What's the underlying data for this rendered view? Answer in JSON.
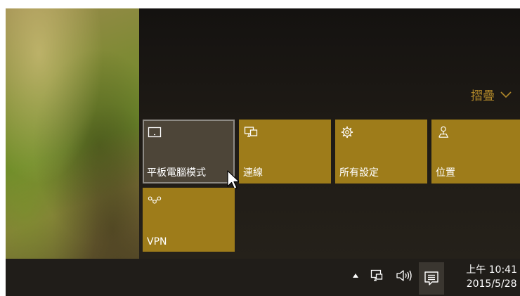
{
  "action_center": {
    "collapse_label": "摺疊",
    "tiles": [
      {
        "label": "平板電腦模式",
        "icon": "tablet-mode-icon",
        "state": "off"
      },
      {
        "label": "連線",
        "icon": "connect-icon",
        "state": "on"
      },
      {
        "label": "所有設定",
        "icon": "gear-icon",
        "state": "on"
      },
      {
        "label": "位置",
        "icon": "location-icon",
        "state": "on"
      },
      {
        "label": "VPN",
        "icon": "vpn-icon",
        "state": "on"
      }
    ]
  },
  "taskbar": {
    "clock": {
      "time": "上午 10:41",
      "date": "2015/5/28"
    },
    "tray_icons": [
      "show-hidden-icons-arrow-icon",
      "network-icon",
      "volume-icon",
      "action-center-icon"
    ]
  },
  "colors": {
    "accent": "#9e7c1a",
    "collapse_text": "#b1882a",
    "off_tile": "#4d4538",
    "taskbar": "#201d19"
  }
}
